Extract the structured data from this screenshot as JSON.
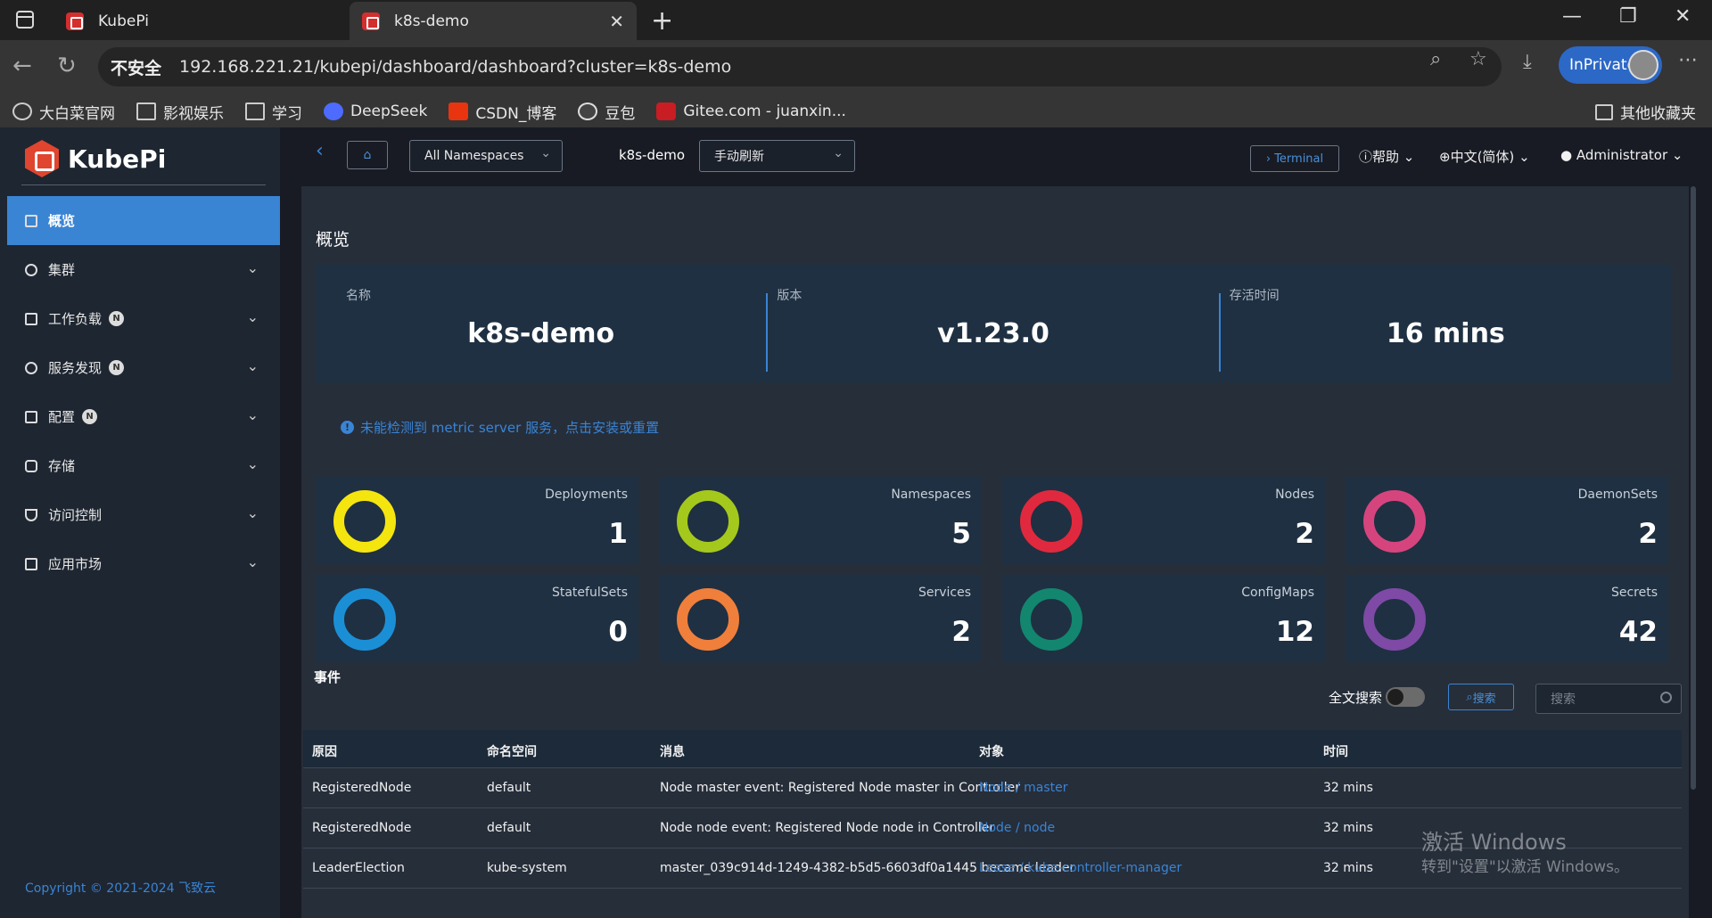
{
  "browser": {
    "tabs": [
      {
        "label": "KubePi"
      },
      {
        "label": "k8s-demo"
      }
    ],
    "security_label": "不安全",
    "url": "192.168.221.21/kubepi/dashboard/dashboard?cluster=k8s-demo",
    "inprivate_label": "InPrivate",
    "bookmarks": [
      {
        "label": "大白菜官网",
        "icon": "globe-icon"
      },
      {
        "label": "影视娱乐",
        "icon": "folder-icon"
      },
      {
        "label": "学习",
        "icon": "folder-icon"
      },
      {
        "label": "DeepSeek",
        "icon": "deepseek-icon"
      },
      {
        "label": "CSDN_博客",
        "icon": "csdn-icon"
      },
      {
        "label": "豆包",
        "icon": "doubao-icon"
      },
      {
        "label": "Gitee.com - juanxin...",
        "icon": "gitee-icon"
      }
    ],
    "other_bookmarks": "其他收藏夹"
  },
  "sidebar": {
    "logo": "KubePi",
    "items": [
      {
        "label": "概览",
        "badge": ""
      },
      {
        "label": "集群",
        "badge": ""
      },
      {
        "label": "工作负载",
        "badge": "N"
      },
      {
        "label": "服务发现",
        "badge": "N"
      },
      {
        "label": "配置",
        "badge": "N"
      },
      {
        "label": "存储",
        "badge": ""
      },
      {
        "label": "访问控制",
        "badge": ""
      },
      {
        "label": "应用市场",
        "badge": ""
      }
    ],
    "copyright": "Copyright © 2021-2024 飞致云"
  },
  "topbar": {
    "namespace_select": "All Namespaces",
    "cluster": "k8s-demo",
    "refresh_select": "手动刷新",
    "terminal": "› Terminal",
    "help": "帮助",
    "language": "中文(简体)",
    "user": "Administrator"
  },
  "overview": {
    "title": "概览",
    "name_label": "名称",
    "name_value": "k8s-demo",
    "version_label": "版本",
    "version_value": "v1.23.0",
    "uptime_label": "存活时间",
    "uptime_value": "16 mins",
    "notice": "未能检测到 metric server 服务，点击安装或重置"
  },
  "cards": [
    {
      "label": "Deployments",
      "value": "1",
      "color": "#f5e50f"
    },
    {
      "label": "Namespaces",
      "value": "5",
      "color": "#a4c91c"
    },
    {
      "label": "Nodes",
      "value": "2",
      "color": "#e0293e"
    },
    {
      "label": "DaemonSets",
      "value": "2",
      "color": "#d6447e"
    },
    {
      "label": "StatefulSets",
      "value": "0",
      "color": "#1b8fd6"
    },
    {
      "label": "Services",
      "value": "2",
      "color": "#f07f3c"
    },
    {
      "label": "ConfigMaps",
      "value": "12",
      "color": "#13866f"
    },
    {
      "label": "Secrets",
      "value": "42",
      "color": "#7e4aa6"
    }
  ],
  "events": {
    "title": "事件",
    "fulltext_label": "全文搜索",
    "search_button": "搜索",
    "search_placeholder": "搜索",
    "columns": [
      "原因",
      "命名空间",
      "消息",
      "对象",
      "时间"
    ],
    "rows": [
      [
        "RegisteredNode",
        "default",
        "Node master event: Registered Node master in Controller",
        "Node / master",
        "32 mins"
      ],
      [
        "RegisteredNode",
        "default",
        "Node node event: Registered Node node in Controller",
        "Node / node",
        "32 mins"
      ],
      [
        "LeaderElection",
        "kube-system",
        "master_039c914d-1249-4382-b5d5-6603df0a1445 became leader",
        "Lease / kube-controller-manager",
        "32 mins"
      ]
    ]
  },
  "watermark": {
    "line1": "激活 Windows",
    "line2": "转到\"设置\"以激活 Windows。"
  }
}
